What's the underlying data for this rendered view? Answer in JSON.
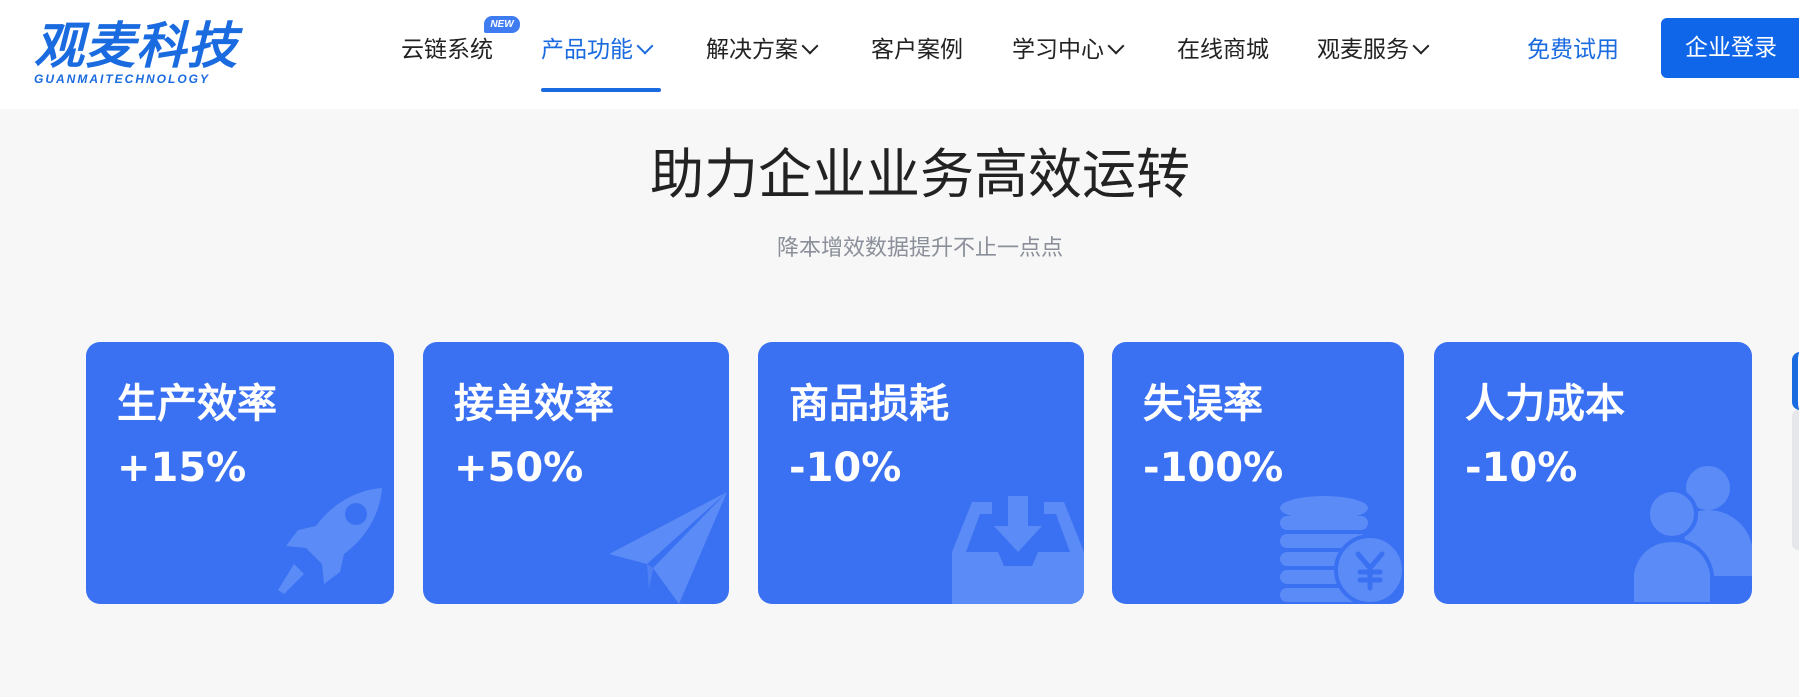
{
  "logo": {
    "name_cn": "观麦科技",
    "name_en": "GUANMAITECHNOLOGY"
  },
  "nav": {
    "badge": "NEW",
    "items": [
      {
        "label": "云链系统",
        "dropdown": false,
        "active": false
      },
      {
        "label": "产品功能",
        "dropdown": true,
        "active": true
      },
      {
        "label": "解决方案",
        "dropdown": true,
        "active": false
      },
      {
        "label": "客户案例",
        "dropdown": false,
        "active": false
      },
      {
        "label": "学习中心",
        "dropdown": true,
        "active": false
      },
      {
        "label": "在线商城",
        "dropdown": false,
        "active": false
      },
      {
        "label": "观麦服务",
        "dropdown": true,
        "active": false
      }
    ],
    "trial": "免费试用",
    "login": "企业登录"
  },
  "hero": {
    "title": "助力企业业务高效运转",
    "subtitle": "降本增效数据提升不止一点点"
  },
  "cards": [
    {
      "label": "生产效率",
      "value": "+15%",
      "icon": "rocket-icon"
    },
    {
      "label": "接单效率",
      "value": "+50%",
      "icon": "paper-plane-icon"
    },
    {
      "label": "商品损耗",
      "value": "-10%",
      "icon": "inbox-download-icon"
    },
    {
      "label": "失误率",
      "value": "-100%",
      "icon": "coins-yen-icon"
    },
    {
      "label": "人力成本",
      "value": "-10%",
      "icon": "users-icon"
    }
  ],
  "colors": {
    "brand": "#1a6be0",
    "card": "#3a70f2",
    "login_button": "#0f66e9",
    "background": "#f7f7f7"
  }
}
